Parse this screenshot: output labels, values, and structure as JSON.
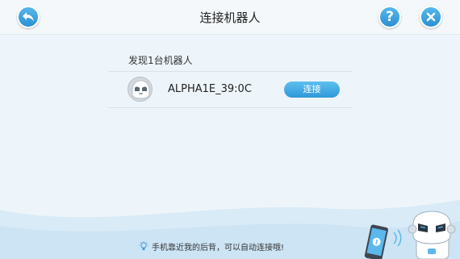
{
  "header": {
    "title": "连接机器人",
    "help_label": "?"
  },
  "main": {
    "found_label": "发现1台机器人",
    "robots": [
      {
        "name": "ALPHA1E_39:0C",
        "action_label": "连接"
      }
    ]
  },
  "footer": {
    "tip": "手机靠近我的后背，可以自动连接哦!"
  },
  "icons": {
    "back": "back-arrow-icon",
    "help": "question-icon",
    "close": "close-icon",
    "avatar": "robot-avatar",
    "tip": "lightbulb-icon",
    "illustration": "phone-robot-illustration"
  },
  "colors": {
    "accent": "#2f98db",
    "background": "#eef5fa"
  }
}
